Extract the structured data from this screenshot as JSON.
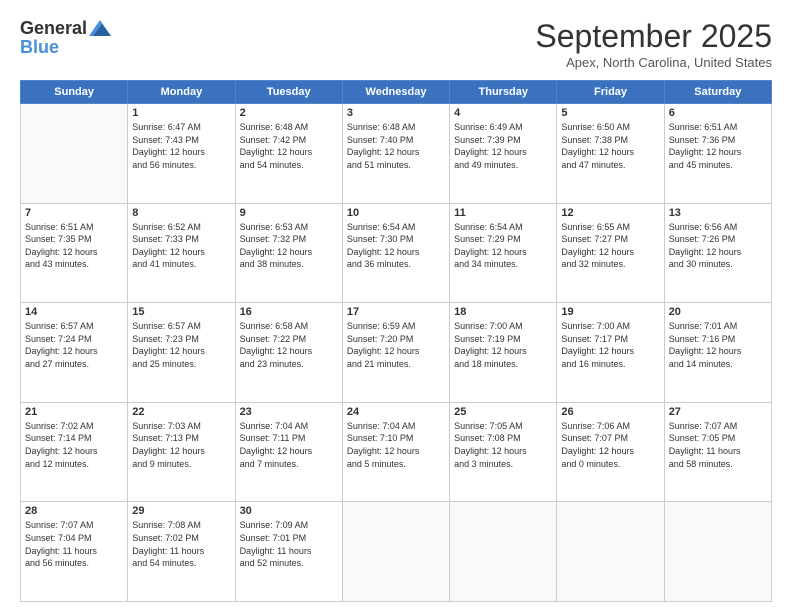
{
  "logo": {
    "general": "General",
    "blue": "Blue"
  },
  "header": {
    "month": "September 2025",
    "location": "Apex, North Carolina, United States"
  },
  "weekdays": [
    "Sunday",
    "Monday",
    "Tuesday",
    "Wednesday",
    "Thursday",
    "Friday",
    "Saturday"
  ],
  "weeks": [
    [
      {
        "day": "",
        "info": ""
      },
      {
        "day": "1",
        "info": "Sunrise: 6:47 AM\nSunset: 7:43 PM\nDaylight: 12 hours\nand 56 minutes."
      },
      {
        "day": "2",
        "info": "Sunrise: 6:48 AM\nSunset: 7:42 PM\nDaylight: 12 hours\nand 54 minutes."
      },
      {
        "day": "3",
        "info": "Sunrise: 6:48 AM\nSunset: 7:40 PM\nDaylight: 12 hours\nand 51 minutes."
      },
      {
        "day": "4",
        "info": "Sunrise: 6:49 AM\nSunset: 7:39 PM\nDaylight: 12 hours\nand 49 minutes."
      },
      {
        "day": "5",
        "info": "Sunrise: 6:50 AM\nSunset: 7:38 PM\nDaylight: 12 hours\nand 47 minutes."
      },
      {
        "day": "6",
        "info": "Sunrise: 6:51 AM\nSunset: 7:36 PM\nDaylight: 12 hours\nand 45 minutes."
      }
    ],
    [
      {
        "day": "7",
        "info": "Sunrise: 6:51 AM\nSunset: 7:35 PM\nDaylight: 12 hours\nand 43 minutes."
      },
      {
        "day": "8",
        "info": "Sunrise: 6:52 AM\nSunset: 7:33 PM\nDaylight: 12 hours\nand 41 minutes."
      },
      {
        "day": "9",
        "info": "Sunrise: 6:53 AM\nSunset: 7:32 PM\nDaylight: 12 hours\nand 38 minutes."
      },
      {
        "day": "10",
        "info": "Sunrise: 6:54 AM\nSunset: 7:30 PM\nDaylight: 12 hours\nand 36 minutes."
      },
      {
        "day": "11",
        "info": "Sunrise: 6:54 AM\nSunset: 7:29 PM\nDaylight: 12 hours\nand 34 minutes."
      },
      {
        "day": "12",
        "info": "Sunrise: 6:55 AM\nSunset: 7:27 PM\nDaylight: 12 hours\nand 32 minutes."
      },
      {
        "day": "13",
        "info": "Sunrise: 6:56 AM\nSunset: 7:26 PM\nDaylight: 12 hours\nand 30 minutes."
      }
    ],
    [
      {
        "day": "14",
        "info": "Sunrise: 6:57 AM\nSunset: 7:24 PM\nDaylight: 12 hours\nand 27 minutes."
      },
      {
        "day": "15",
        "info": "Sunrise: 6:57 AM\nSunset: 7:23 PM\nDaylight: 12 hours\nand 25 minutes."
      },
      {
        "day": "16",
        "info": "Sunrise: 6:58 AM\nSunset: 7:22 PM\nDaylight: 12 hours\nand 23 minutes."
      },
      {
        "day": "17",
        "info": "Sunrise: 6:59 AM\nSunset: 7:20 PM\nDaylight: 12 hours\nand 21 minutes."
      },
      {
        "day": "18",
        "info": "Sunrise: 7:00 AM\nSunset: 7:19 PM\nDaylight: 12 hours\nand 18 minutes."
      },
      {
        "day": "19",
        "info": "Sunrise: 7:00 AM\nSunset: 7:17 PM\nDaylight: 12 hours\nand 16 minutes."
      },
      {
        "day": "20",
        "info": "Sunrise: 7:01 AM\nSunset: 7:16 PM\nDaylight: 12 hours\nand 14 minutes."
      }
    ],
    [
      {
        "day": "21",
        "info": "Sunrise: 7:02 AM\nSunset: 7:14 PM\nDaylight: 12 hours\nand 12 minutes."
      },
      {
        "day": "22",
        "info": "Sunrise: 7:03 AM\nSunset: 7:13 PM\nDaylight: 12 hours\nand 9 minutes."
      },
      {
        "day": "23",
        "info": "Sunrise: 7:04 AM\nSunset: 7:11 PM\nDaylight: 12 hours\nand 7 minutes."
      },
      {
        "day": "24",
        "info": "Sunrise: 7:04 AM\nSunset: 7:10 PM\nDaylight: 12 hours\nand 5 minutes."
      },
      {
        "day": "25",
        "info": "Sunrise: 7:05 AM\nSunset: 7:08 PM\nDaylight: 12 hours\nand 3 minutes."
      },
      {
        "day": "26",
        "info": "Sunrise: 7:06 AM\nSunset: 7:07 PM\nDaylight: 12 hours\nand 0 minutes."
      },
      {
        "day": "27",
        "info": "Sunrise: 7:07 AM\nSunset: 7:05 PM\nDaylight: 11 hours\nand 58 minutes."
      }
    ],
    [
      {
        "day": "28",
        "info": "Sunrise: 7:07 AM\nSunset: 7:04 PM\nDaylight: 11 hours\nand 56 minutes."
      },
      {
        "day": "29",
        "info": "Sunrise: 7:08 AM\nSunset: 7:02 PM\nDaylight: 11 hours\nand 54 minutes."
      },
      {
        "day": "30",
        "info": "Sunrise: 7:09 AM\nSunset: 7:01 PM\nDaylight: 11 hours\nand 52 minutes."
      },
      {
        "day": "",
        "info": ""
      },
      {
        "day": "",
        "info": ""
      },
      {
        "day": "",
        "info": ""
      },
      {
        "day": "",
        "info": ""
      }
    ]
  ]
}
